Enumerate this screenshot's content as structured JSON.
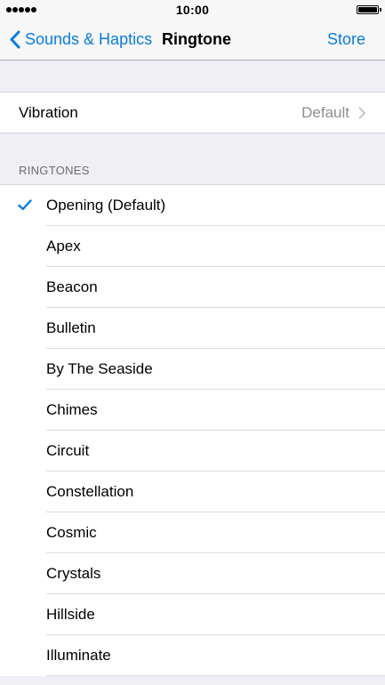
{
  "status_bar": {
    "time": "10:00",
    "signal_bars": 5,
    "battery_level": 1.0
  },
  "nav": {
    "back_label": "Sounds & Haptics",
    "title": "Ringtone",
    "store_label": "Store"
  },
  "vibration": {
    "label": "Vibration",
    "value": "Default"
  },
  "ringtones": {
    "header": "RINGTONES",
    "selected_index": 0,
    "items": [
      {
        "label": "Opening (Default)"
      },
      {
        "label": "Apex"
      },
      {
        "label": "Beacon"
      },
      {
        "label": "Bulletin"
      },
      {
        "label": "By The Seaside"
      },
      {
        "label": "Chimes"
      },
      {
        "label": "Circuit"
      },
      {
        "label": "Constellation"
      },
      {
        "label": "Cosmic"
      },
      {
        "label": "Crystals"
      },
      {
        "label": "Hillside"
      },
      {
        "label": "Illuminate"
      }
    ]
  },
  "colors": {
    "accent": "#0a7cdb",
    "background": "#efeff4",
    "secondary_text": "#8e8e93"
  },
  "icons": {
    "back": "chevron-left-icon",
    "disclosure": "chevron-right-icon",
    "selected": "checkmark-icon"
  }
}
